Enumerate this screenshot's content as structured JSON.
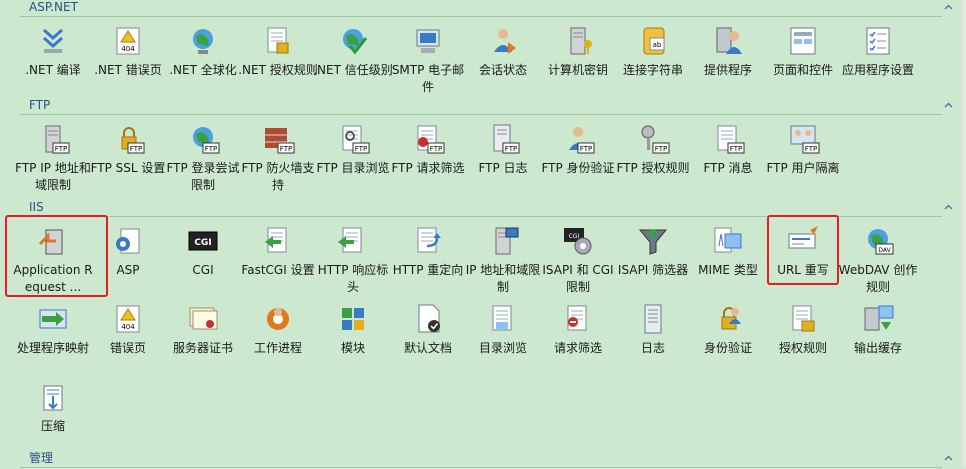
{
  "groups": [
    {
      "title": "ASP.NET",
      "items": [
        {
          "label": ".NET 编译",
          "icon": "download-arrows-icon"
        },
        {
          "label": ".NET 错误页",
          "icon": "error-page-404-icon"
        },
        {
          "label": ".NET 全球化",
          "icon": "globe-icon"
        },
        {
          "label": ".NET 授权规则",
          "icon": "lock-document-icon"
        },
        {
          "label": ".NET 信任级别",
          "icon": "trust-check-icon"
        },
        {
          "label": "SMTP 电子邮件",
          "icon": "email-server-icon"
        },
        {
          "label": "会话状态",
          "icon": "session-users-icon"
        },
        {
          "label": "计算机密钥",
          "icon": "machine-key-icon"
        },
        {
          "label": "连接字符串",
          "icon": "connection-string-icon"
        },
        {
          "label": "提供程序",
          "icon": "providers-icon"
        },
        {
          "label": "页面和控件",
          "icon": "pages-controls-icon"
        },
        {
          "label": "应用程序设置",
          "icon": "app-settings-icon"
        }
      ]
    },
    {
      "title": "FTP",
      "items": [
        {
          "label": "FTP IP 地址和域限制",
          "icon": "ftp-ip-restrict-icon"
        },
        {
          "label": "FTP SSL 设置",
          "icon": "ftp-ssl-lock-icon"
        },
        {
          "label": "FTP 登录尝试限制",
          "icon": "ftp-logon-globe-icon"
        },
        {
          "label": "FTP 防火墙支持",
          "icon": "ftp-firewall-icon"
        },
        {
          "label": "FTP 目录浏览",
          "icon": "ftp-directory-browse-icon"
        },
        {
          "label": "FTP 请求筛选",
          "icon": "ftp-request-filter-icon"
        },
        {
          "label": "FTP 日志",
          "icon": "ftp-log-icon"
        },
        {
          "label": "FTP 身份验证",
          "icon": "ftp-auth-icon"
        },
        {
          "label": "FTP 授权规则",
          "icon": "ftp-authz-key-icon"
        },
        {
          "label": "FTP 消息",
          "icon": "ftp-message-icon"
        },
        {
          "label": "FTP 用户隔离",
          "icon": "ftp-user-isolation-icon"
        }
      ]
    },
    {
      "title": "IIS",
      "items": [
        {
          "label": "Application Request ...",
          "icon": "arr-server-icon"
        },
        {
          "label": "ASP",
          "icon": "asp-gear-icon"
        },
        {
          "label": "CGI",
          "icon": "cgi-icon"
        },
        {
          "label": "FastCGI 设置",
          "icon": "fastcgi-icon"
        },
        {
          "label": "HTTP 响应标头",
          "icon": "http-response-headers-icon"
        },
        {
          "label": "HTTP 重定向",
          "icon": "http-redirect-icon"
        },
        {
          "label": "IP 地址和域限制",
          "icon": "ip-restrict-icon"
        },
        {
          "label": "ISAPI 和 CGI 限制",
          "icon": "isapi-cgi-icon"
        },
        {
          "label": "ISAPI 筛选器",
          "icon": "isapi-filter-funnel-icon"
        },
        {
          "label": "MIME 类型",
          "icon": "mime-types-icon"
        },
        {
          "label": "URL 重写",
          "icon": "url-rewrite-icon"
        },
        {
          "label": "WebDAV 创作规则",
          "icon": "webdav-globe-icon"
        },
        {
          "label": "处理程序映射",
          "icon": "handler-mappings-icon"
        },
        {
          "label": "错误页",
          "icon": "error-page-404-icon"
        },
        {
          "label": "服务器证书",
          "icon": "certificates-icon"
        },
        {
          "label": "工作进程",
          "icon": "worker-process-icon"
        },
        {
          "label": "模块",
          "icon": "modules-icon"
        },
        {
          "label": "默认文档",
          "icon": "default-document-icon"
        },
        {
          "label": "目录浏览",
          "icon": "directory-browse-icon"
        },
        {
          "label": "请求筛选",
          "icon": "request-filter-icon"
        },
        {
          "label": "日志",
          "icon": "log-icon"
        },
        {
          "label": "身份验证",
          "icon": "authentication-icon"
        },
        {
          "label": "授权规则",
          "icon": "authorization-lock-icon"
        },
        {
          "label": "输出缓存",
          "icon": "output-cache-icon"
        },
        {
          "label": "压缩",
          "icon": "compression-icon"
        }
      ]
    },
    {
      "title": "管理",
      "items": []
    }
  ],
  "colors": {
    "background": "#cce8cf",
    "group_title": "#2b4f8a",
    "highlight": "#e02020"
  }
}
